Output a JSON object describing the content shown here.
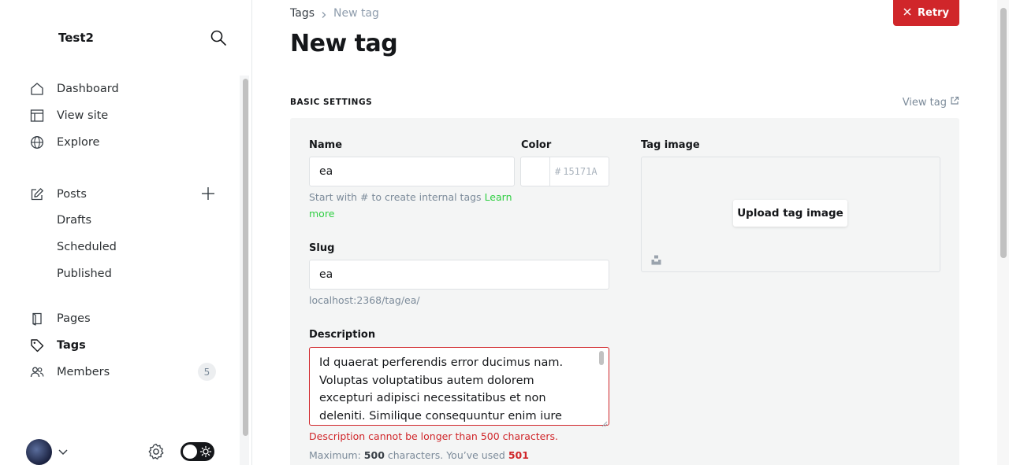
{
  "sidebar": {
    "site_title": "Test2",
    "nav": {
      "dashboard": "Dashboard",
      "view_site": "View site",
      "explore": "Explore",
      "posts": "Posts",
      "drafts": "Drafts",
      "scheduled": "Scheduled",
      "published": "Published",
      "pages": "Pages",
      "tags": "Tags",
      "members": "Members",
      "members_count": "5"
    }
  },
  "header": {
    "breadcrumb_parent": "Tags",
    "breadcrumb_current": "New tag",
    "title": "New tag",
    "retry_label": "Retry"
  },
  "section": {
    "title": "BASIC SETTINGS",
    "view_tag_label": "View tag"
  },
  "form": {
    "name_label": "Name",
    "name_value": "ea",
    "name_hint": "Start with # to create internal tags",
    "learn_more": "Learn more",
    "color_label": "Color",
    "color_hash": "#",
    "color_placeholder": "15171A",
    "slug_label": "Slug",
    "slug_value": "ea",
    "slug_url": "localhost:2368/tag/ea/",
    "description_label": "Description",
    "description_value": "Id quaerat perferendis error ducimus nam. Voluptas voluptatibus autem dolorem excepturi adipisci necessitatibus et non deleniti. Similique consequuntur enim iure consequatur. Mollitia",
    "description_error": "Description cannot be longer than 500 characters.",
    "counter_prefix": "Maximum:",
    "counter_max": "500",
    "counter_mid": "characters. You’ve used",
    "counter_used": "501",
    "tag_image_label": "Tag image",
    "upload_label": "Upload tag image"
  },
  "colors": {
    "accent_green": "#30cf43",
    "error_red": "#d0262a",
    "text_dark": "#15171a"
  }
}
